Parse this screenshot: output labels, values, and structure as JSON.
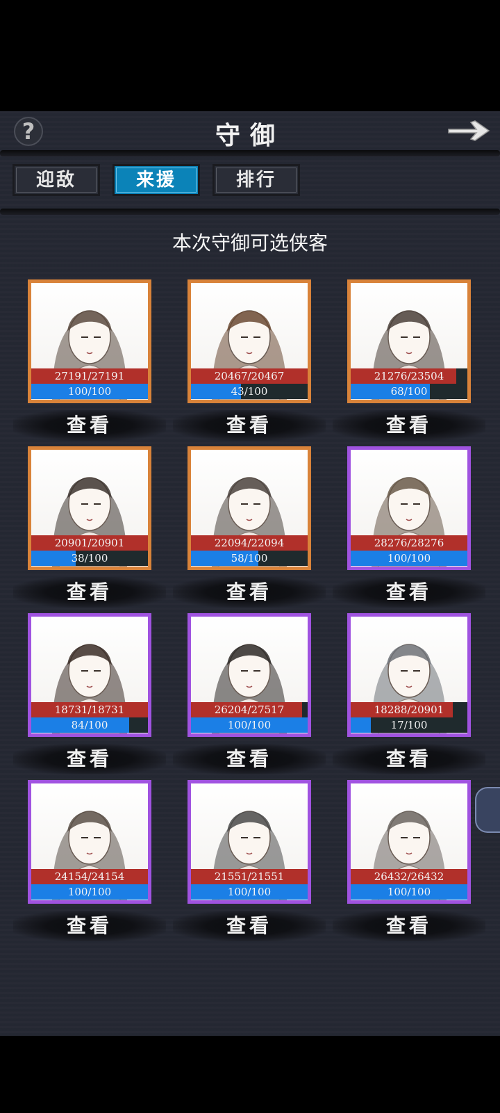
{
  "header": {
    "title": "守御",
    "help_icon": "?",
    "back_icon": "arrow-right-icon"
  },
  "tabs": [
    {
      "label": "迎敌",
      "active": false
    },
    {
      "label": "来援",
      "active": true
    },
    {
      "label": "排行",
      "active": false
    }
  ],
  "subtitle": "本次守御可选侠客",
  "heroes": [
    {
      "hp": "27191/27191",
      "hp_ratio": 1.0,
      "energy": "100/100",
      "energy_ratio": 1.0,
      "rarity": "orange",
      "view_label": "查看"
    },
    {
      "hp": "20467/20467",
      "hp_ratio": 1.0,
      "energy": "43/100",
      "energy_ratio": 0.43,
      "rarity": "orange",
      "view_label": "查看"
    },
    {
      "hp": "21276/23504",
      "hp_ratio": 0.905,
      "energy": "68/100",
      "energy_ratio": 0.68,
      "rarity": "orange",
      "view_label": "查看"
    },
    {
      "hp": "20901/20901",
      "hp_ratio": 1.0,
      "energy": "38/100",
      "energy_ratio": 0.38,
      "rarity": "orange",
      "view_label": "查看"
    },
    {
      "hp": "22094/22094",
      "hp_ratio": 1.0,
      "energy": "58/100",
      "energy_ratio": 0.58,
      "rarity": "orange",
      "view_label": "查看"
    },
    {
      "hp": "28276/28276",
      "hp_ratio": 1.0,
      "energy": "100/100",
      "energy_ratio": 1.0,
      "rarity": "purple",
      "view_label": "查看"
    },
    {
      "hp": "18731/18731",
      "hp_ratio": 1.0,
      "energy": "84/100",
      "energy_ratio": 0.84,
      "rarity": "purple",
      "view_label": "查看"
    },
    {
      "hp": "26204/27517",
      "hp_ratio": 0.952,
      "energy": "100/100",
      "energy_ratio": 1.0,
      "rarity": "purple",
      "view_label": "查看"
    },
    {
      "hp": "18288/20901",
      "hp_ratio": 0.875,
      "energy": "17/100",
      "energy_ratio": 0.17,
      "rarity": "purple",
      "view_label": "查看"
    },
    {
      "hp": "24154/24154",
      "hp_ratio": 1.0,
      "energy": "100/100",
      "energy_ratio": 1.0,
      "rarity": "purple",
      "view_label": "查看"
    },
    {
      "hp": "21551/21551",
      "hp_ratio": 1.0,
      "energy": "100/100",
      "energy_ratio": 1.0,
      "rarity": "purple",
      "view_label": "查看"
    },
    {
      "hp": "26432/26432",
      "hp_ratio": 1.0,
      "energy": "100/100",
      "energy_ratio": 1.0,
      "rarity": "purple",
      "view_label": "查看"
    }
  ],
  "colors": {
    "background": "#252833",
    "orange_frame": "#d9833a",
    "purple_frame": "#a053e0",
    "hp_fill": "#b1302a",
    "energy_fill": "#1b7fe6",
    "active_tab": "#0b83b8"
  }
}
